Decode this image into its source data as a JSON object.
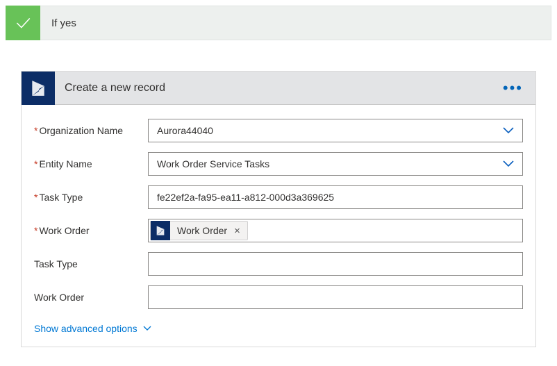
{
  "condition": {
    "title": "If yes"
  },
  "card": {
    "title": "Create a new record",
    "advanced": "Show advanced options",
    "chip": {
      "label": "Work Order"
    },
    "fields": {
      "orgName": {
        "label": "Organization Name",
        "required": true,
        "value": "Aurora44040",
        "dropdown": true
      },
      "entity": {
        "label": "Entity Name",
        "required": true,
        "value": "Work Order Service Tasks",
        "dropdown": true
      },
      "taskTypeR": {
        "label": "Task Type",
        "required": true,
        "value": "fe22ef2a-fa95-ea11-a812-000d3a369625"
      },
      "workOrder": {
        "label": "Work Order",
        "required": true
      },
      "taskType2": {
        "label": "Task Type",
        "required": false,
        "value": ""
      },
      "workOrder2": {
        "label": "Work Order",
        "required": false,
        "value": ""
      }
    }
  }
}
